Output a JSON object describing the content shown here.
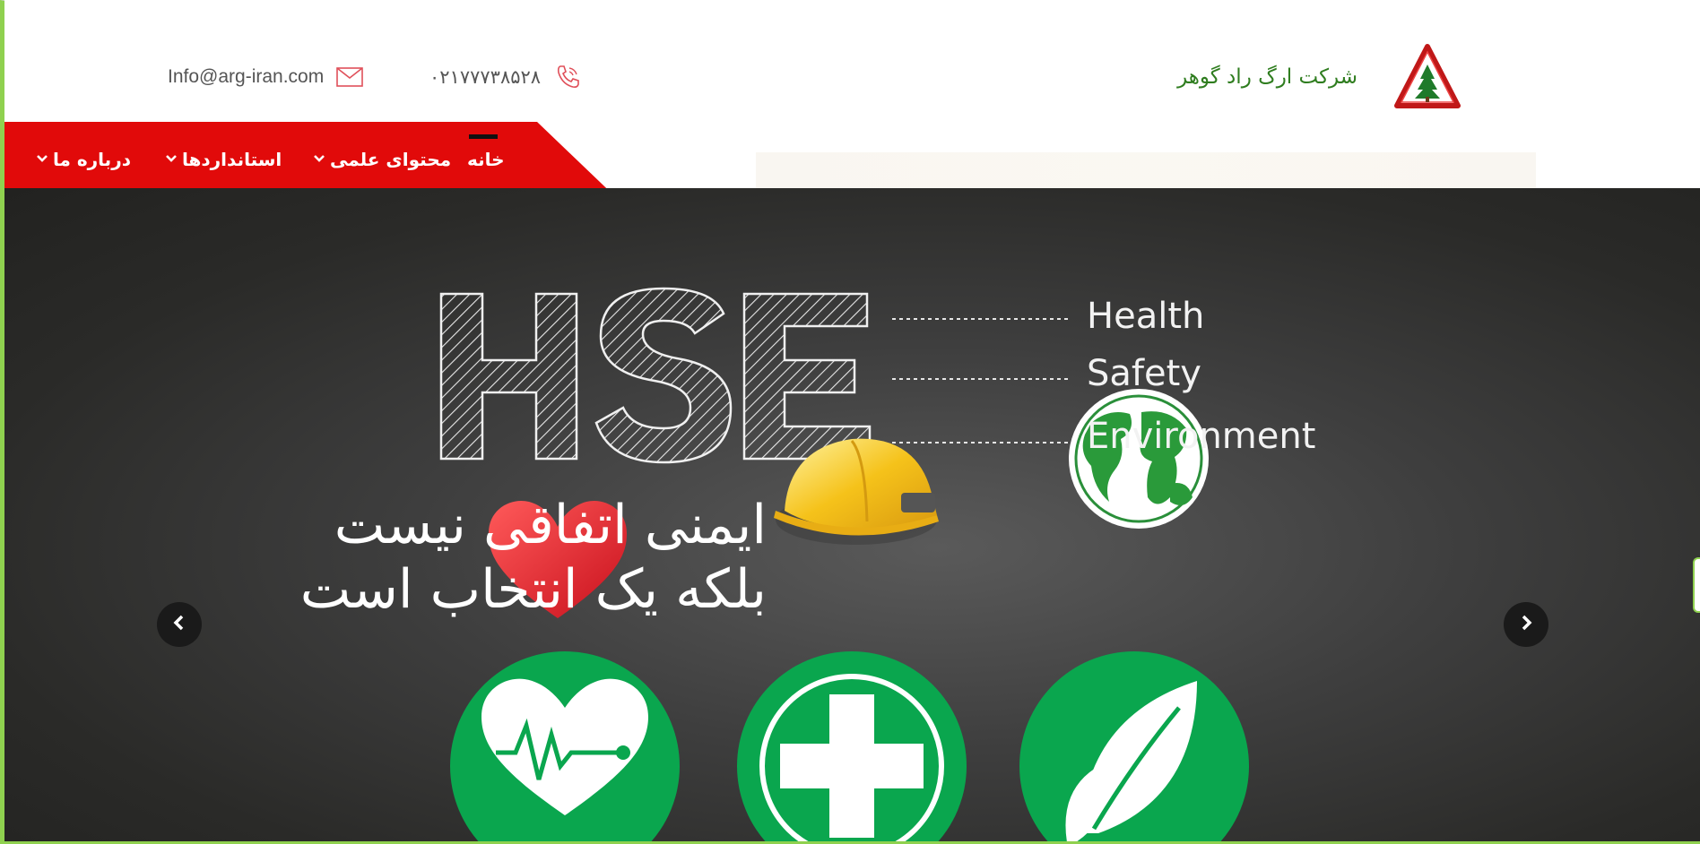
{
  "header": {
    "email": "Info@arg-iran.com",
    "phone": "۰۲۱۷۷۷۳۸۵۲۸",
    "company_name": "شرکت ارگ راد گوهر",
    "logo_icon": "tree-warning-triangle-logo"
  },
  "nav": {
    "items": [
      {
        "label": "خانه",
        "has_dropdown": false,
        "active": true
      },
      {
        "label": "محتوای علمی",
        "has_dropdown": true
      },
      {
        "label": "استانداردها",
        "has_dropdown": true
      },
      {
        "label": "درباره ما",
        "has_dropdown": true
      }
    ],
    "chevron": "⌄"
  },
  "hero": {
    "hse_title": "HSE",
    "lines": [
      "Health",
      "Safety",
      "Environment"
    ],
    "slogan_line1": "ایمنی اتفاقی نیست",
    "slogan_line2": "بلکه یک انتخاب است",
    "prev_icon": "chevron-left-icon",
    "next_icon": "chevron-right-icon"
  },
  "colors": {
    "nav_red": "#e10a0a",
    "brand_green": "#2f7d1f",
    "icon_green": "#0aa64e",
    "helmet_yellow": "#f5c21a",
    "heart_red": "#e0202a"
  }
}
